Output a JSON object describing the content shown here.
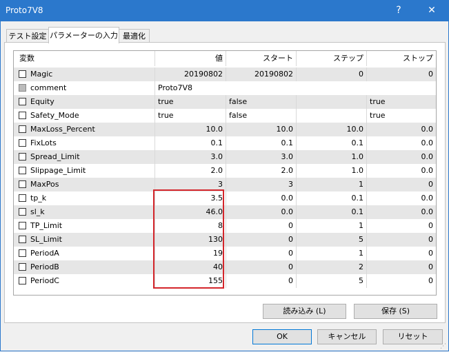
{
  "window": {
    "title": "Proto7V8",
    "help_label": "?",
    "close_label": "✕"
  },
  "tabs": [
    {
      "label": "テスト設定",
      "active": false
    },
    {
      "label": "パラメーターの入力",
      "active": true
    },
    {
      "label": "最適化",
      "active": false
    }
  ],
  "grid": {
    "columns": [
      "変数",
      "値",
      "スタート",
      "ステップ",
      "ストップ"
    ],
    "rows": [
      {
        "name": "Magic",
        "checkbox": "unchecked",
        "value": "20190802",
        "start": "20190802",
        "step": "0",
        "stop": "0"
      },
      {
        "name": "comment",
        "checkbox": "disabled",
        "value": "Proto7V8",
        "start": "",
        "step": "",
        "stop": ""
      },
      {
        "name": "Equity",
        "checkbox": "unchecked",
        "value": "true",
        "start": "false",
        "step": "",
        "stop": "true"
      },
      {
        "name": "Safety_Mode",
        "checkbox": "unchecked",
        "value": "true",
        "start": "false",
        "step": "",
        "stop": "true"
      },
      {
        "name": "MaxLoss_Percent",
        "checkbox": "unchecked",
        "value": "10.0",
        "start": "10.0",
        "step": "10.0",
        "stop": "0.0"
      },
      {
        "name": "FixLots",
        "checkbox": "unchecked",
        "value": "0.1",
        "start": "0.1",
        "step": "0.1",
        "stop": "0.0"
      },
      {
        "name": "Spread_Limit",
        "checkbox": "unchecked",
        "value": "3.0",
        "start": "3.0",
        "step": "1.0",
        "stop": "0.0"
      },
      {
        "name": "Slippage_Limit",
        "checkbox": "unchecked",
        "value": "2.0",
        "start": "2.0",
        "step": "1.0",
        "stop": "0.0"
      },
      {
        "name": "MaxPos",
        "checkbox": "unchecked",
        "value": "3",
        "start": "3",
        "step": "1",
        "stop": "0"
      },
      {
        "name": "tp_k",
        "checkbox": "unchecked",
        "value": "3.5",
        "start": "0.0",
        "step": "0.1",
        "stop": "0.0"
      },
      {
        "name": "sl_k",
        "checkbox": "unchecked",
        "value": "46.0",
        "start": "0.0",
        "step": "0.1",
        "stop": "0.0"
      },
      {
        "name": "TP_Limit",
        "checkbox": "unchecked",
        "value": "8",
        "start": "0",
        "step": "1",
        "stop": "0"
      },
      {
        "name": "SL_Limit",
        "checkbox": "unchecked",
        "value": "130",
        "start": "0",
        "step": "5",
        "stop": "0"
      },
      {
        "name": "PeriodA",
        "checkbox": "unchecked",
        "value": "19",
        "start": "0",
        "step": "1",
        "stop": "0"
      },
      {
        "name": "PeriodB",
        "checkbox": "unchecked",
        "value": "40",
        "start": "0",
        "step": "2",
        "stop": "0"
      },
      {
        "name": "PeriodC",
        "checkbox": "unchecked",
        "value": "155",
        "start": "0",
        "step": "5",
        "stop": "0"
      }
    ]
  },
  "buttons": {
    "load": "読み込み (L)",
    "save": "保存 (S)",
    "ok": "OK",
    "cancel": "キャンセル",
    "reset": "リセット"
  },
  "colors": {
    "titlebar": "#2b78cc",
    "highlight": "#d4252b",
    "row_alt": "#e6e6e6"
  }
}
